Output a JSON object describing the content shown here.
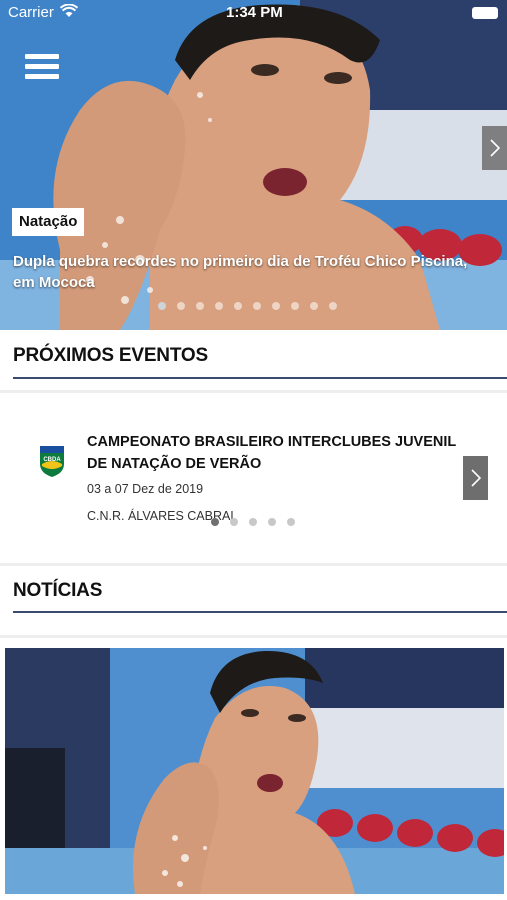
{
  "status_bar": {
    "carrier": "Carrier",
    "time": "1:34 PM"
  },
  "hero": {
    "category": "Natação",
    "headline": "Dupla quebra recordes no primeiro dia de Troféu Chico Piscina, em Mococa",
    "slide_count": 10,
    "active_slide": 1
  },
  "events_section": {
    "title": "PRÓXIMOS EVENTOS",
    "event": {
      "logo_text": "CBDA",
      "title": "CAMPEONATO BRASILEIRO INTERCLUBES JUVENIL DE NATAÇÃO DE VERÃO",
      "date": "03 a 07 Dez de 2019",
      "venue": "C.N.R. ÁLVARES CABRAL"
    },
    "slide_count": 5,
    "active_slide": 1
  },
  "news_section": {
    "title": "NOTÍCIAS"
  },
  "colors": {
    "accent_rule": "#3a4a70",
    "pool_blue": "#4f8fcf"
  }
}
